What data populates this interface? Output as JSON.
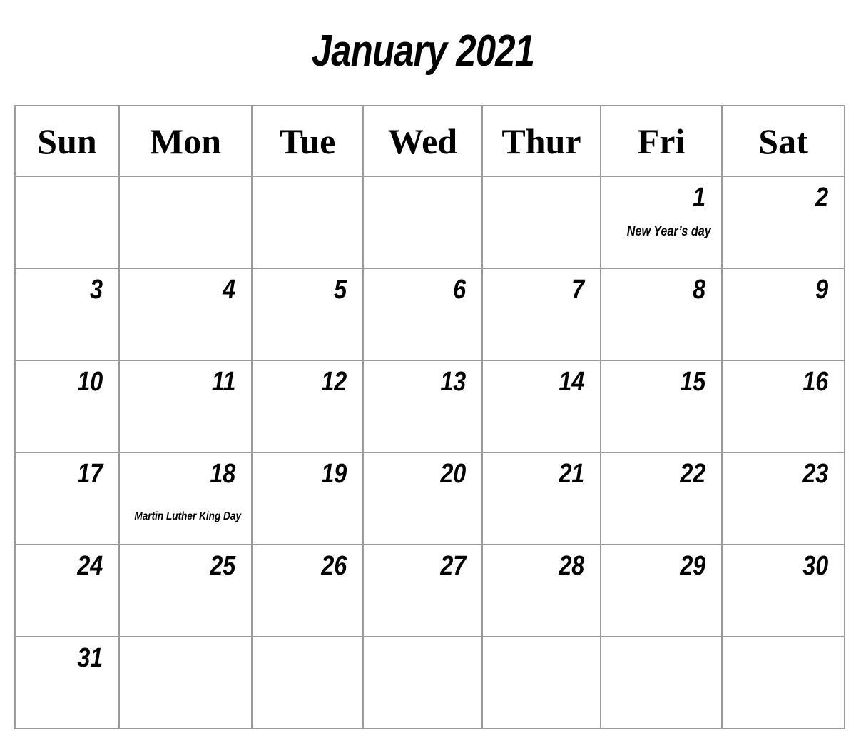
{
  "title": "January 2021",
  "weekdays": [
    "Sun",
    "Mon",
    "Tue",
    "Wed",
    "Thur",
    "Fri",
    "Sat"
  ],
  "weeks": [
    [
      {
        "day": ""
      },
      {
        "day": ""
      },
      {
        "day": ""
      },
      {
        "day": ""
      },
      {
        "day": ""
      },
      {
        "day": "1",
        "note": "New Year’s day"
      },
      {
        "day": "2"
      }
    ],
    [
      {
        "day": "3"
      },
      {
        "day": "4"
      },
      {
        "day": "5"
      },
      {
        "day": "6"
      },
      {
        "day": "7"
      },
      {
        "day": "8"
      },
      {
        "day": "9"
      }
    ],
    [
      {
        "day": "10"
      },
      {
        "day": "11"
      },
      {
        "day": "12"
      },
      {
        "day": "13"
      },
      {
        "day": "14"
      },
      {
        "day": "15"
      },
      {
        "day": "16"
      }
    ],
    [
      {
        "day": "17"
      },
      {
        "day": "18",
        "note": "Martin Luther King Day"
      },
      {
        "day": "19"
      },
      {
        "day": "20"
      },
      {
        "day": "21"
      },
      {
        "day": "22"
      },
      {
        "day": "23"
      }
    ],
    [
      {
        "day": "24"
      },
      {
        "day": "25"
      },
      {
        "day": "26"
      },
      {
        "day": "27"
      },
      {
        "day": "28"
      },
      {
        "day": "29"
      },
      {
        "day": "30"
      }
    ],
    [
      {
        "day": "31"
      },
      {
        "day": ""
      },
      {
        "day": ""
      },
      {
        "day": ""
      },
      {
        "day": ""
      },
      {
        "day": ""
      },
      {
        "day": ""
      }
    ]
  ]
}
